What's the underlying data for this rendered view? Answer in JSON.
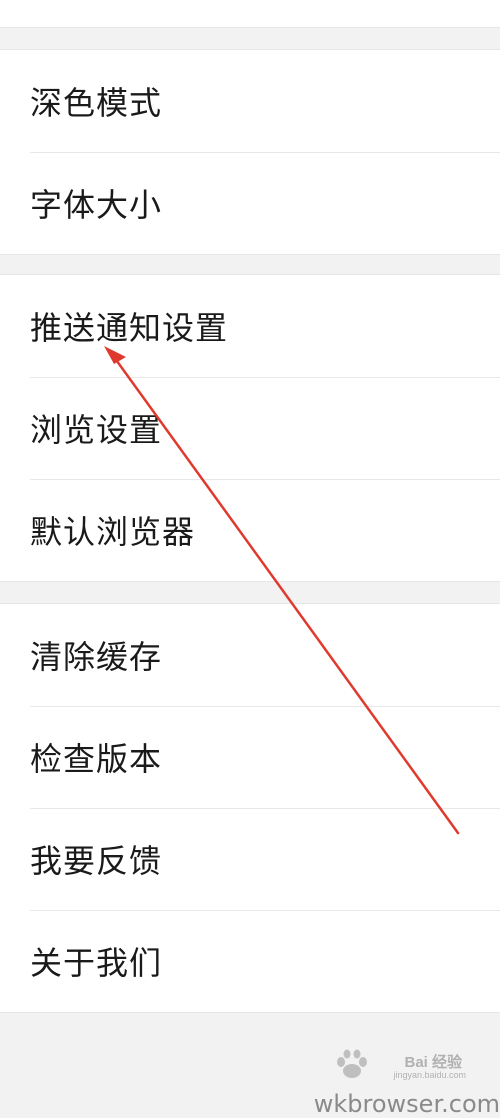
{
  "groups": [
    {
      "items": [
        {
          "label": "深色模式"
        },
        {
          "label": "字体大小"
        }
      ]
    },
    {
      "items": [
        {
          "label": "推送通知设置"
        },
        {
          "label": "浏览设置"
        },
        {
          "label": "默认浏览器"
        }
      ]
    },
    {
      "items": [
        {
          "label": "清除缓存"
        },
        {
          "label": "检查版本"
        },
        {
          "label": "我要反馈"
        },
        {
          "label": "关于我们"
        }
      ]
    }
  ],
  "annotation": {
    "arrow_color": "#e03a2e",
    "arrow_target": "推送通知设置"
  },
  "watermark": {
    "brand": "Bai 经验",
    "sub": "jingyan.baidu.com",
    "icon": "baidu-paw-icon"
  },
  "footer": {
    "url_text": "wkbrowser.com"
  }
}
